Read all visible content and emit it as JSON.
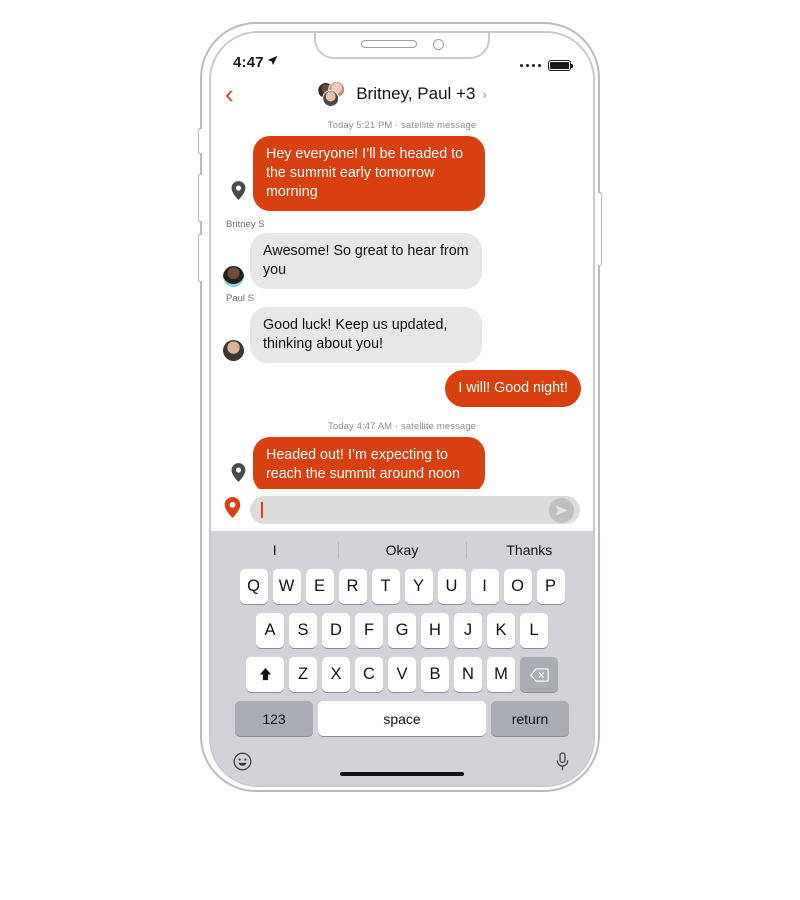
{
  "status_bar": {
    "time": "4:47",
    "location_arrow_icon": "location-arrow-icon",
    "signal_dots": 4,
    "battery_icon": "battery-full-icon"
  },
  "nav_bar": {
    "back_icon": "chevron-left-icon",
    "title": "Britney, Paul +3",
    "chevron": "›",
    "avatar_group_icon": "group-avatars-icon"
  },
  "conversation": [
    {
      "type": "timestamp",
      "text": "Today 5:21 PM · satellite message"
    },
    {
      "type": "outgoing",
      "pin_icon": "location-pin-icon",
      "text": "Hey everyone! I’ll be headed to the summit early tomorrow morning"
    },
    {
      "type": "incoming",
      "sender": "Britney S",
      "avatar_icon": "avatar-britney",
      "text": "Awesome! So great to hear from you"
    },
    {
      "type": "incoming",
      "sender": "Paul S",
      "avatar_icon": "avatar-paul",
      "text": "Good luck! Keep us updated, thinking about you!"
    },
    {
      "type": "outgoing_pill",
      "text": "I will! Good night!"
    },
    {
      "type": "timestamp",
      "text": "Today 4:47 AM · satellite message"
    },
    {
      "type": "outgoing",
      "pin_icon": "location-pin-icon",
      "text": "Headed out! I’m expecting to reach the summit around noon"
    }
  ],
  "input_bar": {
    "pin_icon": "location-pin-icon",
    "value": "",
    "placeholder": "",
    "send_icon": "send-paper-plane-icon"
  },
  "keyboard": {
    "suggestions": [
      "I",
      "Okay",
      "Thanks"
    ],
    "row1": [
      "Q",
      "W",
      "E",
      "R",
      "T",
      "Y",
      "U",
      "I",
      "O",
      "P"
    ],
    "row2": [
      "A",
      "S",
      "D",
      "F",
      "G",
      "H",
      "J",
      "K",
      "L"
    ],
    "row3": [
      "Z",
      "X",
      "C",
      "V",
      "B",
      "N",
      "M"
    ],
    "shift_icon": "shift-arrow-icon",
    "delete_icon": "backspace-icon",
    "numeric_label": "123",
    "space_label": "space",
    "return_label": "return",
    "emoji_icon": "emoji-smiley-icon",
    "mic_icon": "microphone-icon"
  },
  "colors": {
    "accent_orange": "#d8400f",
    "incoming_bubble": "#e7e7e8",
    "keyboard_bg": "#d1d3d8",
    "key_dark": "#aaadb4",
    "field_bg": "#dcdcdd"
  }
}
